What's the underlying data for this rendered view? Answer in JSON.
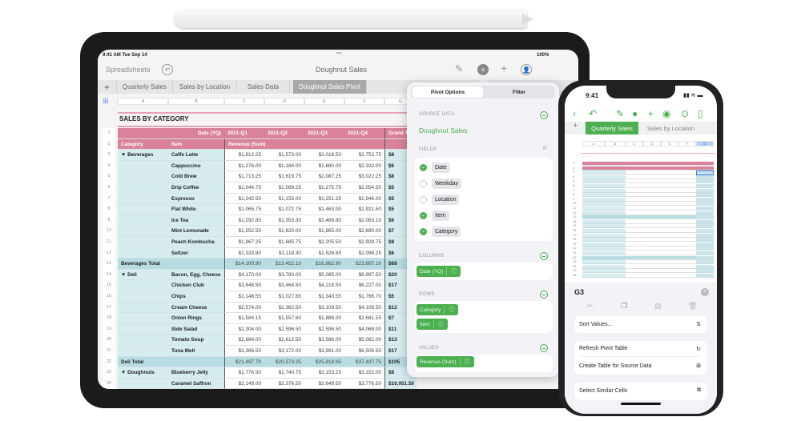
{
  "ipad": {
    "status": {
      "time": "9:41 AM  Tue Sep 14",
      "dots": "•••",
      "battery": "100%"
    },
    "toolbar": {
      "back": "Spreadsheets",
      "title": "Doughnut Sales"
    },
    "tabs": [
      "Quarterly Sales",
      "Sales by Location",
      "Sales Data",
      "Doughnut Sales Pivot"
    ],
    "columns": [
      "A",
      "B",
      "C",
      "D",
      "E",
      "F",
      "G"
    ],
    "table_title": "SALES BY CATEGORY",
    "header1": {
      "label": "Date (YQ)",
      "q": [
        "2021-Q1",
        "2021-Q2",
        "2021-Q3",
        "2021-Q4"
      ],
      "grand": "Grand Total"
    },
    "header2": {
      "category": "Category",
      "item": "Item",
      "value": "Revenue (Sum)"
    },
    "rows": [
      {
        "n": "3",
        "cat": "▼  Beverages",
        "item": "Caffe Latte",
        "v": [
          "$1,812.25",
          "$1,573.00",
          "$2,018.50",
          "$2,752.75"
        ],
        "g": "$8"
      },
      {
        "n": "4",
        "cat": "",
        "item": "Cappuccino",
        "v": [
          "$1,276.00",
          "$1,184.00",
          "$1,680.00",
          "$2,332.00"
        ],
        "g": "$6"
      },
      {
        "n": "5",
        "cat": "",
        "item": "Cold Brew",
        "v": [
          "$1,713.25",
          "$1,619.75",
          "$2,087.25",
          "$3,022.25"
        ],
        "g": "$8"
      },
      {
        "n": "6",
        "cat": "",
        "item": "Drip Coffee",
        "v": [
          "$1,044.75",
          "$1,069.25",
          "$1,275.75",
          "$2,054.50"
        ],
        "g": "$5"
      },
      {
        "n": "7",
        "cat": "",
        "item": "Espresso",
        "v": [
          "$1,242.50",
          "$1,155.00",
          "$1,251.25",
          "$1,946.00"
        ],
        "g": "$5"
      },
      {
        "n": "8",
        "cat": "",
        "item": "Flat White",
        "v": [
          "$1,065.75",
          "$1,072.75",
          "$1,463.00",
          "$1,921.50"
        ],
        "g": "$5"
      },
      {
        "n": "9",
        "cat": "",
        "item": "Ice Tea",
        "v": [
          "$1,292.85",
          "$1,353.30",
          "$1,489.80",
          "$2,063.10"
        ],
        "g": "$6"
      },
      {
        "n": "10",
        "cat": "",
        "item": "Mint Lemonade",
        "v": [
          "$1,552.50",
          "$1,620.00",
          "$1,865.00",
          "$2,690.00"
        ],
        "g": "$7"
      },
      {
        "n": "11",
        "cat": "",
        "item": "Peach Kombucha",
        "v": [
          "$1,867.25",
          "$1,685.75",
          "$2,205.50",
          "$2,928.75"
        ],
        "g": "$8"
      },
      {
        "n": "12",
        "cat": "",
        "item": "Seltzer",
        "v": [
          "$1,333.80",
          "$1,119.30",
          "$1,526.85",
          "$2,096.25"
        ],
        "g": "$6"
      },
      {
        "n": "13",
        "total": true,
        "cat": "Beverages Total",
        "item": "",
        "v": [
          "$14,200.90",
          "$13,452.10",
          "$16,862.90",
          "$23,807.10"
        ],
        "g": "$68"
      },
      {
        "n": "14",
        "cat": "▼  Deli",
        "item": "Bacon, Egg, Cheese",
        "v": [
          "$4,170.00",
          "$3,780.00",
          "$5,085.00",
          "$6,997.50"
        ],
        "g": "$20"
      },
      {
        "n": "15",
        "cat": "",
        "item": "Chicken Club",
        "v": [
          "$3,646.50",
          "$3,464.50",
          "$4,218.50",
          "$6,227.00"
        ],
        "g": "$17"
      },
      {
        "n": "16",
        "cat": "",
        "item": "Chips",
        "v": [
          "$1,148.55",
          "$1,027.65",
          "$1,343.55",
          "$1,766.70"
        ],
        "g": "$5"
      },
      {
        "n": "17",
        "cat": "",
        "item": "Cream Cheese",
        "v": [
          "$2,574.00",
          "$2,362.50",
          "$3,109.50",
          "$4,108.50"
        ],
        "g": "$12"
      },
      {
        "n": "18",
        "cat": "",
        "item": "Onion Rings",
        "v": [
          "$1,584.15",
          "$1,557.60",
          "$1,888.00",
          "$2,681.55"
        ],
        "g": "$7"
      },
      {
        "n": "19",
        "cat": "",
        "item": "Side Salad",
        "v": [
          "$2,304.00",
          "$2,596.50",
          "$2,596.50",
          "$4,068.00"
        ],
        "g": "$11"
      },
      {
        "n": "20",
        "cat": "",
        "item": "Tomato Soup",
        "v": [
          "$2,684.00",
          "$2,612.50",
          "$3,586.00",
          "$5,082.00"
        ],
        "g": "$13"
      },
      {
        "n": "21",
        "cat": "",
        "item": "Tuna Melt",
        "v": [
          "$3,386.50",
          "$3,172.00",
          "$3,991.00",
          "$6,506.50"
        ],
        "g": "$17"
      },
      {
        "n": "22",
        "total": true,
        "cat": "Deli Total",
        "item": "",
        "v": [
          "$21,497.70",
          "$20,573.25",
          "$25,818.05",
          "$37,437.75"
        ],
        "g": "$105"
      },
      {
        "n": "23",
        "cat": "▼  Doughnuts",
        "item": "Blueberry Jelly",
        "v": [
          "$1,776.50",
          "$1,740.75",
          "$2,153.25",
          "$3,322.00"
        ],
        "g": "$8"
      },
      {
        "n": "24",
        "cat": "",
        "item": "Caramel Saffron",
        "v": [
          "$2,149.00",
          "$2,376.50",
          "$2,649.50",
          "$3,776.50"
        ],
        "g": "$10,951.50"
      }
    ]
  },
  "pivot": {
    "segments": [
      "Pivot Options",
      "Filter"
    ],
    "source_label": "SOURCE DATA",
    "source": "Doughnut Sales",
    "fields_label": "FIELDS",
    "fields": [
      {
        "name": "Date",
        "checked": true
      },
      {
        "name": "Weekday",
        "checked": false
      },
      {
        "name": "Location",
        "checked": false
      },
      {
        "name": "Item",
        "checked": true
      },
      {
        "name": "Category",
        "checked": true
      }
    ],
    "columns_label": "COLUMNS",
    "columns": [
      "Date (YQ)"
    ],
    "rows_label": "ROWS",
    "rows": [
      "Category",
      "Item"
    ],
    "values_label": "VALUES",
    "values": [
      "Revenue (Sum)"
    ],
    "info": "ⓘ"
  },
  "iphone": {
    "time": "9:41",
    "tabs": [
      "Quarterly Sales",
      "Sales by Location"
    ],
    "columns": [
      "A",
      "B",
      "C",
      "D",
      "E",
      "F",
      "G"
    ],
    "cell_ref": "G3",
    "menu": {
      "sort": "Sort Values...",
      "refresh": "Refresh Pivot Table",
      "create": "Create Table for Source Data",
      "select": "Select Similar Cells"
    }
  },
  "colors": {
    "accent": "#4caf50",
    "header_pink": "#d9829a",
    "row_blue": "#d6ecef",
    "total_teal": "#b7dde3"
  }
}
